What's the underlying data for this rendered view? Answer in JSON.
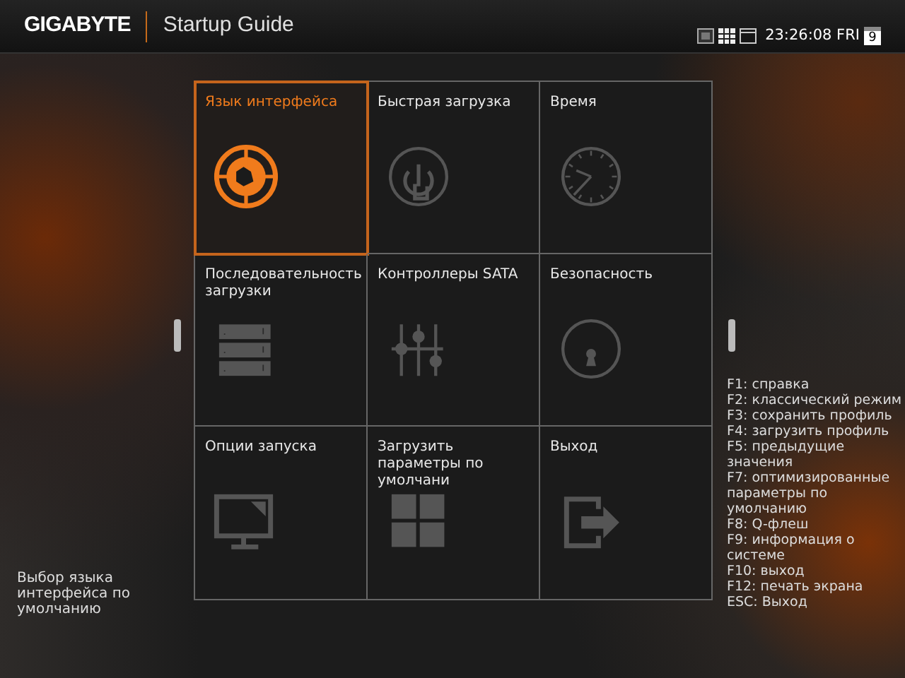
{
  "header": {
    "brand": "GIGABYTE",
    "title": "Startup Guide",
    "time": "23:26:08 FRI",
    "date_day": "9"
  },
  "tiles": [
    {
      "label": "Язык интерфейса",
      "kind": "language",
      "selected": true
    },
    {
      "label": "Быстрая загрузка",
      "kind": "fastboot",
      "selected": false
    },
    {
      "label": "Время",
      "kind": "clock",
      "selected": false
    },
    {
      "label": "Последовательность загрузки",
      "kind": "bootorder",
      "selected": false
    },
    {
      "label": "Контроллеры SATA",
      "kind": "sliders",
      "selected": false
    },
    {
      "label": "Безопасность",
      "kind": "lock",
      "selected": false
    },
    {
      "label": "Опции запуска",
      "kind": "monitor",
      "selected": false
    },
    {
      "label": "Загрузить параметры по умолчани",
      "kind": "defaults",
      "selected": false
    },
    {
      "label": "Выход",
      "kind": "exit",
      "selected": false
    }
  ],
  "description": "Выбор языка интерфейса по умолчанию",
  "hotkeys": [
    "F1: справка",
    "F2: классический режим",
    "F3: сохранить профиль",
    "F4: загрузить профиль",
    "F5: предыдущие значения",
    "F7: оптимизированные параметры по умолчанию",
    "F8: Q-флеш",
    "F9: информация о системе",
    "F10: выход",
    "F12: печать экрана",
    "ESC: Выход"
  ]
}
